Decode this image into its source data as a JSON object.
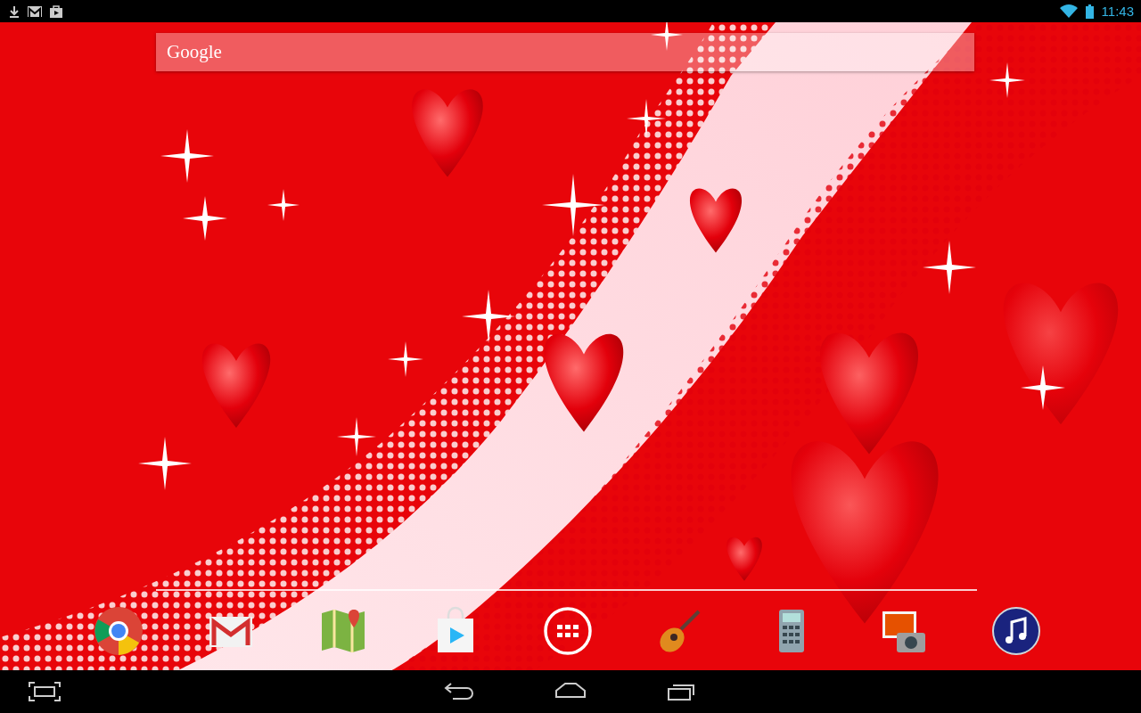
{
  "status_bar": {
    "time": "11:43"
  },
  "search_bar": {
    "label": "Google"
  }
}
